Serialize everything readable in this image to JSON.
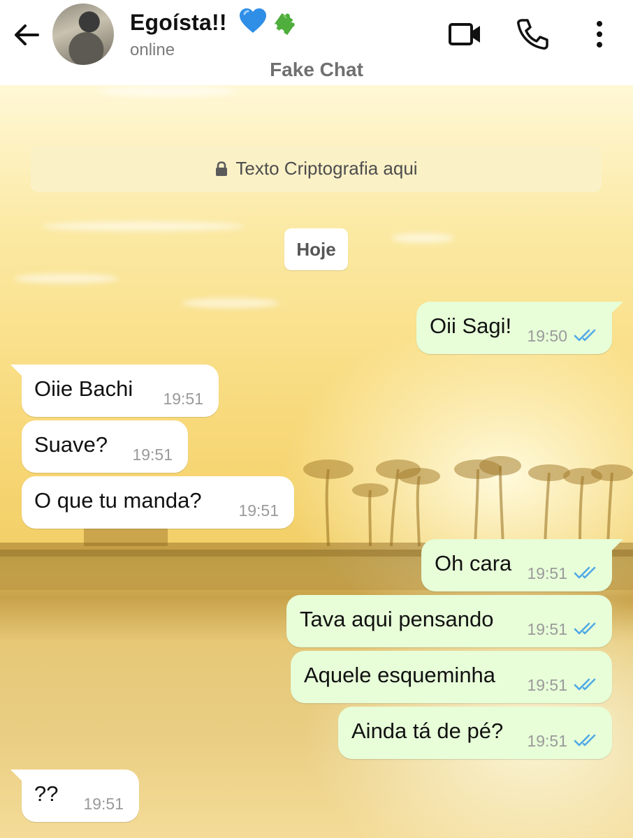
{
  "header": {
    "contact_name": "Egoísta!!",
    "status": "online",
    "watermark": "Fake Chat",
    "icons": [
      "back-arrow-icon",
      "blue-heart-emoji",
      "puzzle-piece-emoji",
      "video-call-icon",
      "phone-icon",
      "more-options-icon"
    ]
  },
  "notice": {
    "encryption_text": "Texto Criptografia aqui",
    "day_label": "Hoje"
  },
  "colors": {
    "incoming_bubble": "#ffffff",
    "outgoing_bubble": "#e7fed8",
    "read_ticks": "#4fa8e6",
    "encryption_notice_bg": "#fbf1c7"
  },
  "messages": [
    {
      "direction": "outgoing",
      "text": "Oii Sagi!",
      "time": "19:50",
      "status": "read"
    },
    {
      "direction": "incoming",
      "text": "Oiie Bachi",
      "time": "19:51"
    },
    {
      "direction": "incoming",
      "text": "Suave?",
      "time": "19:51"
    },
    {
      "direction": "incoming",
      "text": "O que tu manda?",
      "time": "19:51"
    },
    {
      "direction": "outgoing",
      "text": "Oh cara",
      "time": "19:51",
      "status": "read"
    },
    {
      "direction": "outgoing",
      "text": "Tava aqui pensando",
      "time": "19:51",
      "status": "read"
    },
    {
      "direction": "outgoing",
      "text": "Aquele esqueminha",
      "time": "19:51",
      "status": "read"
    },
    {
      "direction": "outgoing",
      "text": "Ainda tá de pé?",
      "time": "19:51",
      "status": "read"
    },
    {
      "direction": "incoming",
      "text": "??",
      "time": "19:51"
    }
  ]
}
